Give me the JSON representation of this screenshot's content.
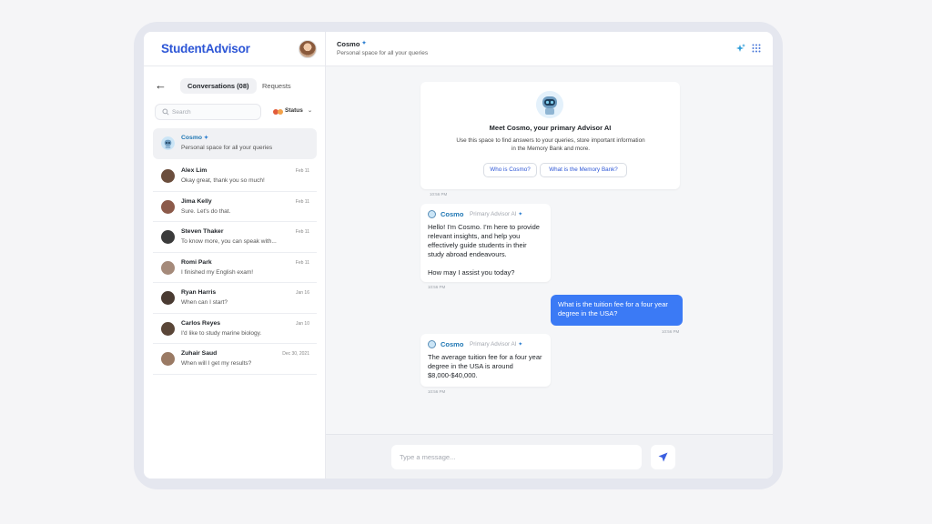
{
  "app": {
    "logo": "StudentAdvisor"
  },
  "sidebar": {
    "back_icon": "arrow-left-icon",
    "tabs": [
      {
        "label": "Conversations (08)",
        "active": true
      },
      {
        "label": "Requests",
        "active": false
      }
    ],
    "search": {
      "placeholder": "Search",
      "value": ""
    },
    "status": {
      "label": "Status",
      "dot_colors": [
        "#e25c3b",
        "#f3a24a"
      ]
    },
    "conversations": [
      {
        "name": "Cosmo",
        "preview": "Personal space for all your queries",
        "date": "",
        "selected": true,
        "is_ai": true
      },
      {
        "name": "Alex Lim",
        "preview": "Okay great, thank you so much!",
        "date": "Feb 11",
        "avatar_color": "#6b4e3d"
      },
      {
        "name": "Jima Kelly",
        "preview": "Sure. Let's do that.",
        "date": "Feb 11",
        "avatar_color": "#8c5a4a"
      },
      {
        "name": "Steven Thaker",
        "preview": "To know more, you can speak with...",
        "date": "Feb 11",
        "avatar_color": "#3b3b3b"
      },
      {
        "name": "Romi Park",
        "preview": "I finished my English exam!",
        "date": "Feb 11",
        "avatar_color": "#a58a7a"
      },
      {
        "name": "Ryan Harris",
        "preview": "When can I start?",
        "date": "Jan 16",
        "avatar_color": "#4a3b32"
      },
      {
        "name": "Carlos Reyes",
        "preview": "I'd like to study marine biology.",
        "date": "Jan 10",
        "avatar_color": "#5a4638"
      },
      {
        "name": "Zuhair Saud",
        "preview": "When will I get my results?",
        "date": "Dec 30, 2021",
        "avatar_color": "#9a7a64"
      }
    ]
  },
  "chat": {
    "header": {
      "title": "Cosmo",
      "subtitle": "Personal space for all your queries"
    },
    "header_icons": [
      "ai-sparkle-icon",
      "apps-grid-icon"
    ],
    "intro": {
      "title": "Meet Cosmo, your primary Advisor AI",
      "text": "Use this space to find answers to your queries, store important information in the Memory Bank and more.",
      "chips": [
        "Who is Cosmo?",
        "What is the Memory Bank?"
      ],
      "time": "10:56 PM"
    },
    "messages": [
      {
        "from": "bot",
        "name": "Cosmo",
        "role": "Primary Advisor AI",
        "text": "Hello! I'm Cosmo. I'm here to provide relevant insights, and help you effectively guide students in their study abroad endeavours.\n\nHow may I assist you today?",
        "time": "10:56 PM"
      },
      {
        "from": "user",
        "text": "What is the tuition fee for a four year degree in the USA?",
        "time": "10:56 PM"
      },
      {
        "from": "bot",
        "name": "Cosmo",
        "role": "Primary Advisor AI",
        "text": "The average tuition fee for a four year degree in the USA is around $8,000-$40,000.",
        "time": "10:56 PM"
      }
    ],
    "composer": {
      "placeholder": "Type a message...",
      "value": ""
    }
  }
}
